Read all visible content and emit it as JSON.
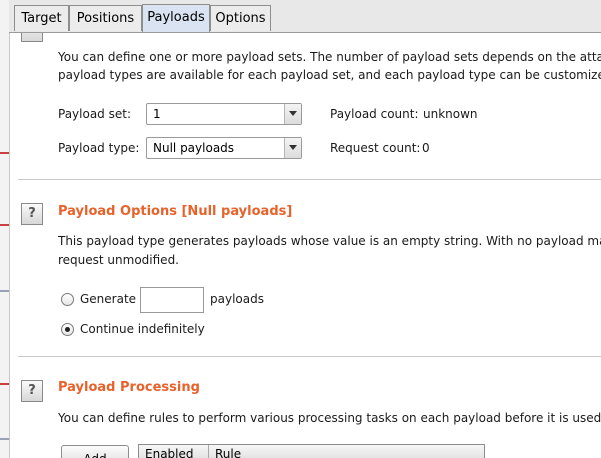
{
  "tabs": [
    {
      "label": "Target"
    },
    {
      "label": "Positions"
    },
    {
      "label": "Payloads"
    },
    {
      "label": "Options"
    }
  ],
  "payload_sets": {
    "intro_line1": "You can define one or more payload sets. The number of payload sets depends on the attack t",
    "intro_line2": "payload types are available for each payload set, and each payload type can be customized in",
    "set_label": "Payload set:",
    "set_value": "1",
    "count_label": "Payload count:",
    "count_value": "unknown",
    "type_label": "Payload type:",
    "type_value": "Null payloads",
    "request_label": "Request count:",
    "request_value": "0"
  },
  "options_section": {
    "help": "?",
    "title": "Payload Options [Null payloads]",
    "desc_line1": "This payload type generates payloads whose value is an empty string. With no payload marke",
    "desc_line2": "request unmodified.",
    "generate_label": "Generate",
    "generate_value": "",
    "payloads_suffix": "payloads",
    "continue_label": "Continue indefinitely",
    "selected": "continue"
  },
  "processing_section": {
    "help": "?",
    "title": "Payload Processing",
    "desc": "You can define rules to perform various processing tasks on each payload before it is used.",
    "add_button": "Add",
    "columns": [
      "Enabled",
      "Rule"
    ]
  },
  "colors": {
    "heading": "#e8622c",
    "active_tab": "#d9e3f2"
  }
}
